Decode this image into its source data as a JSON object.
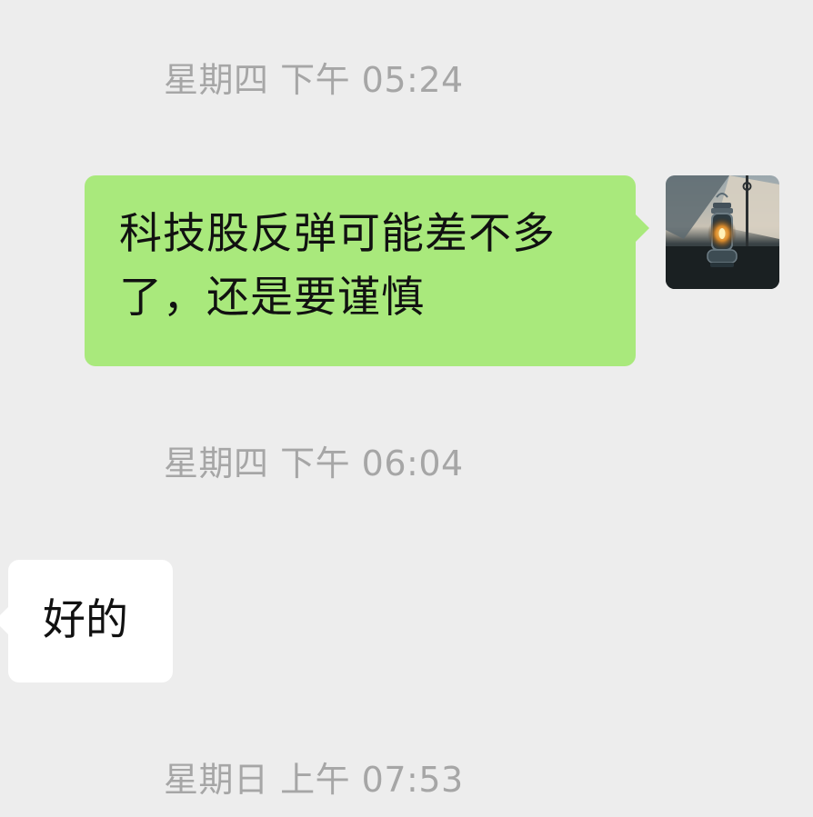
{
  "messages": [
    {
      "type": "timestamp",
      "text": "星期四 下午 05:24"
    },
    {
      "type": "outgoing",
      "text": "科技股反弹可能差不多了，还是要谨慎",
      "avatar_icon": "lantern-avatar-icon"
    },
    {
      "type": "timestamp",
      "text": "星期四 下午 06:04"
    },
    {
      "type": "incoming",
      "text": "好的"
    },
    {
      "type": "timestamp",
      "text": "星期日 上午 07:53"
    }
  ],
  "colors": {
    "background": "#ededed",
    "outgoing_bubble": "#a9e97c",
    "incoming_bubble": "#ffffff",
    "timestamp_text": "#a6a6a6",
    "message_text": "#111111"
  }
}
